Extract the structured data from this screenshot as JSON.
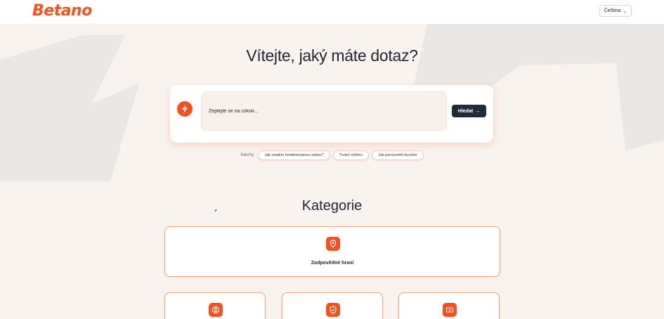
{
  "header": {
    "logo_text": "Betano",
    "language": "Čeština"
  },
  "hero": {
    "title": "Vítejte, jaký máte dotaz?"
  },
  "search": {
    "placeholder": "Zeptejte se na cokoli...",
    "button_label": "Hledat",
    "button_arrow": "→"
  },
  "suggestions": {
    "label": "Návrhy",
    "items": [
      "Jak vsadím kombinovanou sázku?",
      "Trvání výběru",
      "Jak porozumět kurzům"
    ]
  },
  "categories": {
    "title": "Kategorie",
    "items": [
      {
        "label": "Zodpovědné hraní",
        "icon": "location-pin-icon"
      },
      {
        "label": "",
        "icon": "user-icon"
      },
      {
        "label": "",
        "icon": "shield-check-icon"
      },
      {
        "label": "",
        "icon": "payment-card-icon"
      }
    ]
  },
  "colors": {
    "brand": "#f4511e",
    "dark_button": "#1f2a3a",
    "background": "#f8f3ee"
  }
}
